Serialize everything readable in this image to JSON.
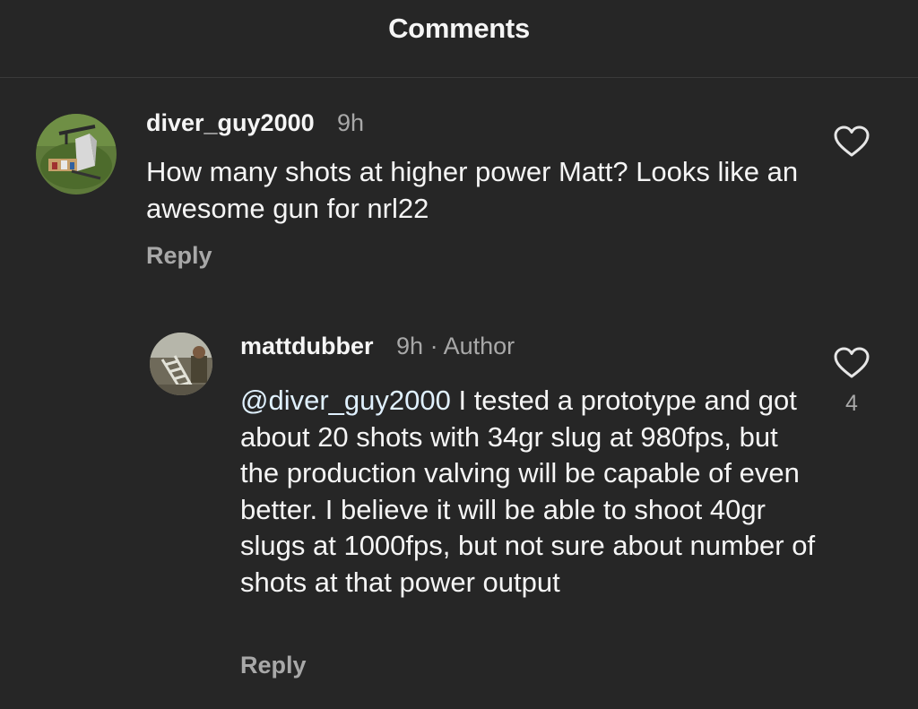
{
  "header": {
    "title": "Comments"
  },
  "comments": [
    {
      "username": "diver_guy2000",
      "time": "9h",
      "text": "How many shots at higher power Matt?  Looks like an awesome gun for nrl22",
      "reply_label": "Reply"
    }
  ],
  "replies": [
    {
      "username": "mattdubber",
      "time": "9h",
      "separator": "·",
      "badge": "Author",
      "mention": "@diver_guy2000",
      "text": " I tested a prototype and got about 20 shots with 34gr slug at 980fps, but the production valving will be capable of even better. I believe it will be able to shoot 40gr slugs at 1000fps, but not sure about number of shots at that power output",
      "like_count": "4",
      "reply_label": "Reply"
    }
  ],
  "icons": {
    "like": "heart-outline-icon"
  },
  "colors": {
    "background": "#262626",
    "text_primary": "#f5f5f5",
    "text_secondary": "#a8a8a8",
    "mention": "#e0f1ff"
  }
}
